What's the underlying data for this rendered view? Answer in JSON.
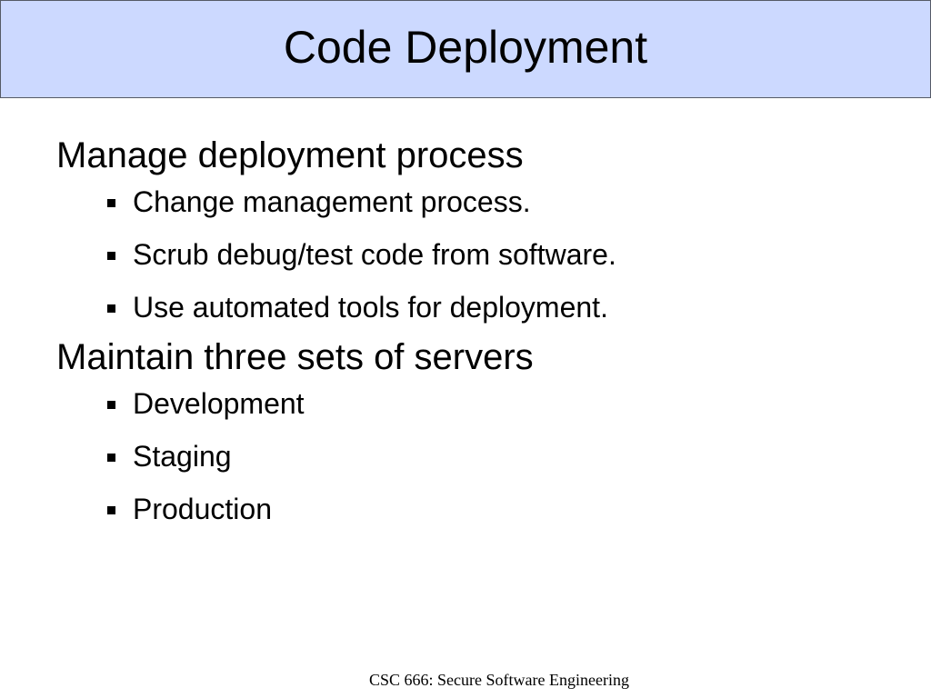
{
  "slide": {
    "title": "Code Deployment",
    "sections": [
      {
        "heading": "Manage deployment process",
        "bullets": [
          "Change management process.",
          "Scrub debug/test code from software.",
          "Use automated tools for deployment."
        ]
      },
      {
        "heading": "Maintain three sets of servers",
        "bullets": [
          "Development",
          "Staging",
          "Production"
        ]
      }
    ],
    "footer": "CSC 666: Secure Software Engineering"
  },
  "colors": {
    "title_background": "#ccd9ff",
    "title_border": "#555a66",
    "text": "#000000"
  },
  "icons": {
    "bullet": "square-bullet-icon"
  }
}
